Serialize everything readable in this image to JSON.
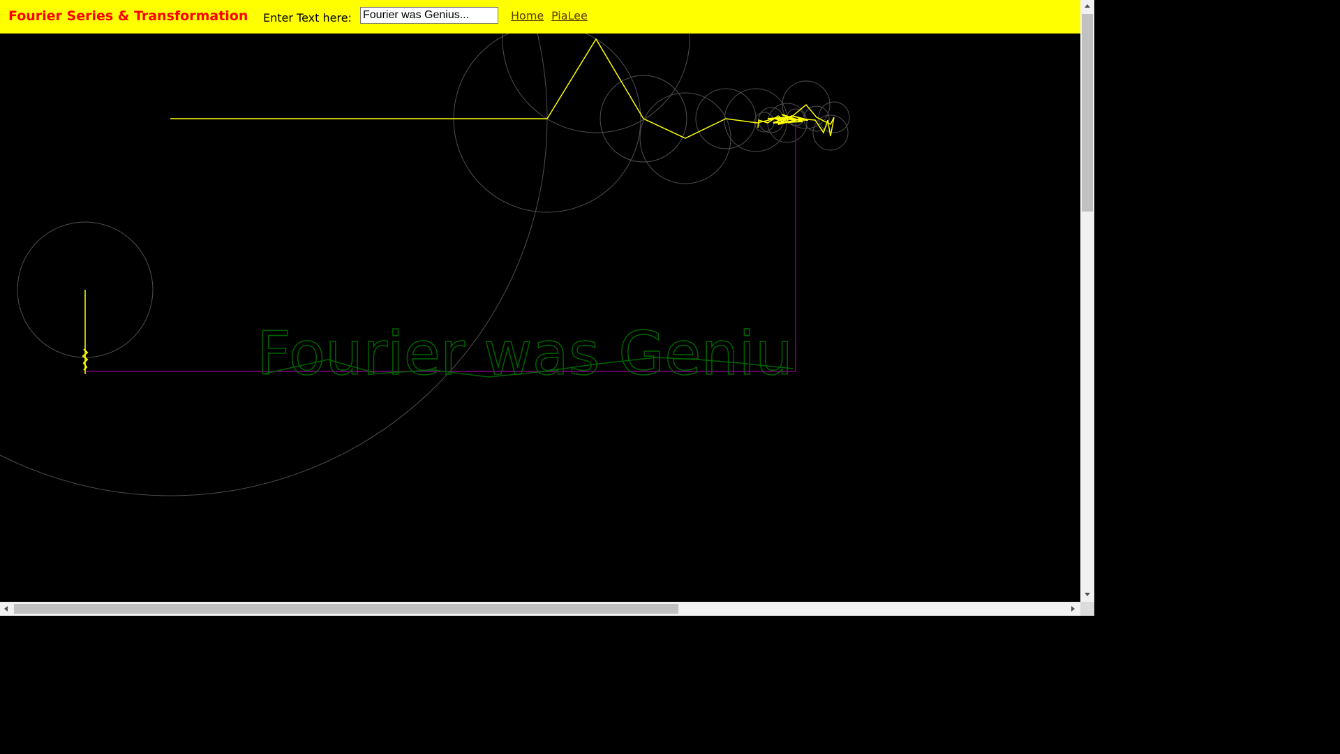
{
  "header": {
    "title": "Fourier Series & Transformation",
    "input_label": "Enter Text here:",
    "input_value": "Fourier was Genius...",
    "links": [
      "Home",
      "PiaLee"
    ]
  },
  "canvas": {
    "drawn_text": "Fourier was Geniu",
    "colors": {
      "background": "#000000",
      "epicycle_circles": "#505050",
      "arm_lines": "#ffff00",
      "connector_line": "#800080",
      "text_outline": "#006400"
    }
  },
  "colors": {
    "topbar": "#ffff00",
    "title": "#ff0000",
    "link": "#5b3f00"
  }
}
